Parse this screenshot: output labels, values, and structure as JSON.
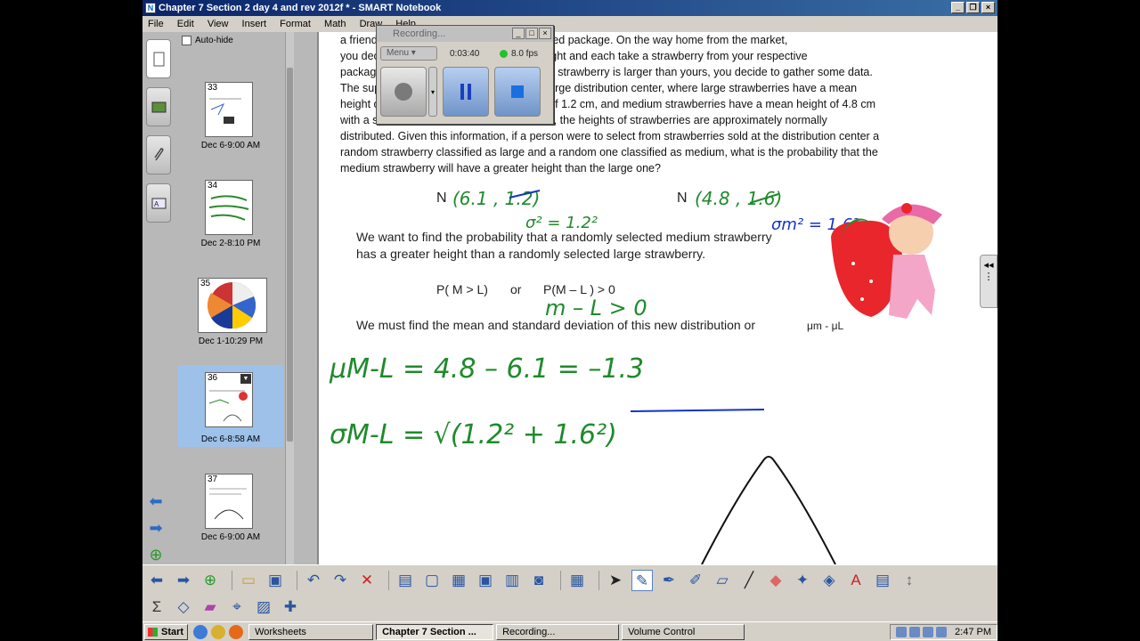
{
  "window": {
    "title": "Chapter 7 Section 2 day 4 and rev 2012f * - SMART Notebook",
    "controls": [
      "_",
      "❐",
      "×"
    ]
  },
  "menu": [
    "File",
    "Edit",
    "View",
    "Insert",
    "Format",
    "Math",
    "Draw",
    "Help"
  ],
  "sorter": {
    "autohide_label": "Auto-hide",
    "pages": [
      {
        "num": "33",
        "caption": "Dec 6-9:00 AM"
      },
      {
        "num": "34",
        "caption": "Dec 2-8:10 PM"
      },
      {
        "num": "35",
        "caption": "Dec 1-10:29 PM"
      },
      {
        "num": "36",
        "caption": "Dec 6-8:58 AM",
        "selected": true
      },
      {
        "num": "37",
        "caption": "Dec 6-9:00 AM"
      }
    ]
  },
  "recorder": {
    "title": "Recording...",
    "menu_label": "Menu",
    "elapsed": "0:03:40",
    "fps": "8.0 fps"
  },
  "page": {
    "problem_lines": [
      "a friend decide to purchase the medium sized package. On the way home from the market,",
      "you decide to eat some of the fruit you bought and each take a strawberry from your respective",
      "package. Surprised to find that your friend's strawberry is larger than yours, you decide to gather some data.",
      "The supermarket buys its produce from a large distribution center, where large strawberries have a mean",
      "height of 6.1 cm with a standard deviation of 1.2 cm, and medium strawberries have a mean height of 4.8 cm",
      "with a standard deviation of 1.6 cm.  Further, the heights of strawberries are approximately normally",
      "distributed.  Given this information, if a person were to select from strawberries sold at the distribution center a",
      "random strawberry classified as large and a random one classified as medium, what is the probability that the",
      "medium strawberry will have a greater height than the large one?"
    ],
    "normal_large": "N",
    "normal_medium": "N",
    "want_line1": "We want to find the probability that a randomly selected medium strawberry",
    "want_line2": "has a greater height than a randomly selected large strawberry.",
    "prob_a": "P( M > L)",
    "prob_or": "or",
    "prob_b": "P(M – L ) > 0",
    "mean_line": "We must find the mean and standard deviation of this new distribution or",
    "mu_label": "μm - μL",
    "ink": {
      "large_params": "(6.1 , 1.2)",
      "large_var": "σ² = 1.2²",
      "medium_params": "(4.8 , 1.6)",
      "medium_var": "σm² = 1.6²",
      "diff": "m – L > 0",
      "mean_calc": "μM-L = 4.8 – 6.1 = –1.3",
      "sd_calc": "σM-L = √(1.2² + 1.6²)"
    }
  },
  "taskbar": {
    "start": "Start",
    "tasks": [
      "Worksheets",
      "Chapter 7 Section ...",
      "Recording...",
      "Volume Control"
    ],
    "active_task": 1,
    "clock": "2:47 PM"
  },
  "colors": {
    "ink_green": "#1f8a2c",
    "ink_blue": "#1533c7",
    "title_blue": "#0a246a"
  }
}
